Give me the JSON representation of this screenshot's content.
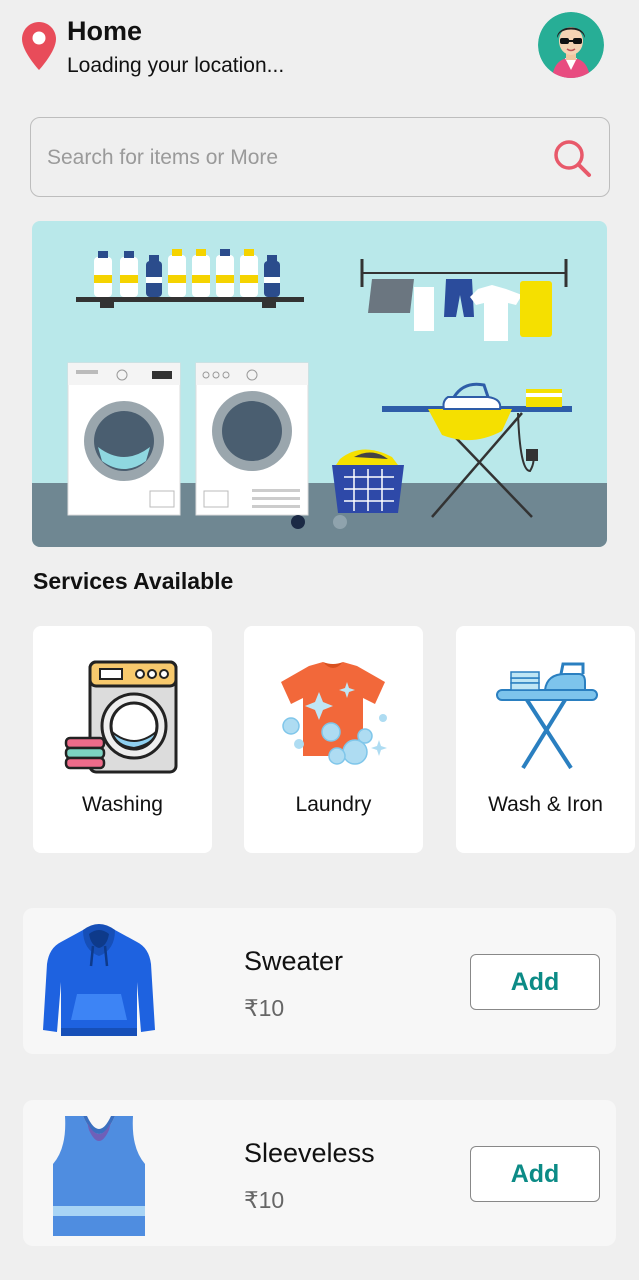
{
  "header": {
    "title": "Home",
    "subtitle": "Loading your location...",
    "icons": [
      "location-pin-icon",
      "avatar"
    ]
  },
  "search": {
    "placeholder": "Search for items or More",
    "icon": "search-icon"
  },
  "banner": {
    "slide_count": 2,
    "active_slide": 1
  },
  "services": {
    "title": "Services Available",
    "items": [
      {
        "label": "Washing",
        "icon": "washing-machine-icon"
      },
      {
        "label": "Laundry",
        "icon": "tshirt-bubbles-icon"
      },
      {
        "label": "Wash & Iron",
        "icon": "ironing-board-icon"
      }
    ]
  },
  "items": [
    {
      "name": "Sweater",
      "price": "₹10",
      "button": "Add",
      "icon": "hoodie-icon"
    },
    {
      "name": "Sleeveless",
      "price": "₹10",
      "button": "Add",
      "icon": "tank-top-icon"
    }
  ],
  "colors": {
    "background": "#efefef",
    "accent": "#0c8b86",
    "pin": "#e84c5a",
    "search_icon": "#e8596a",
    "dot_active": "#1b2a45",
    "dot_inactive": "#8fa3ad"
  }
}
